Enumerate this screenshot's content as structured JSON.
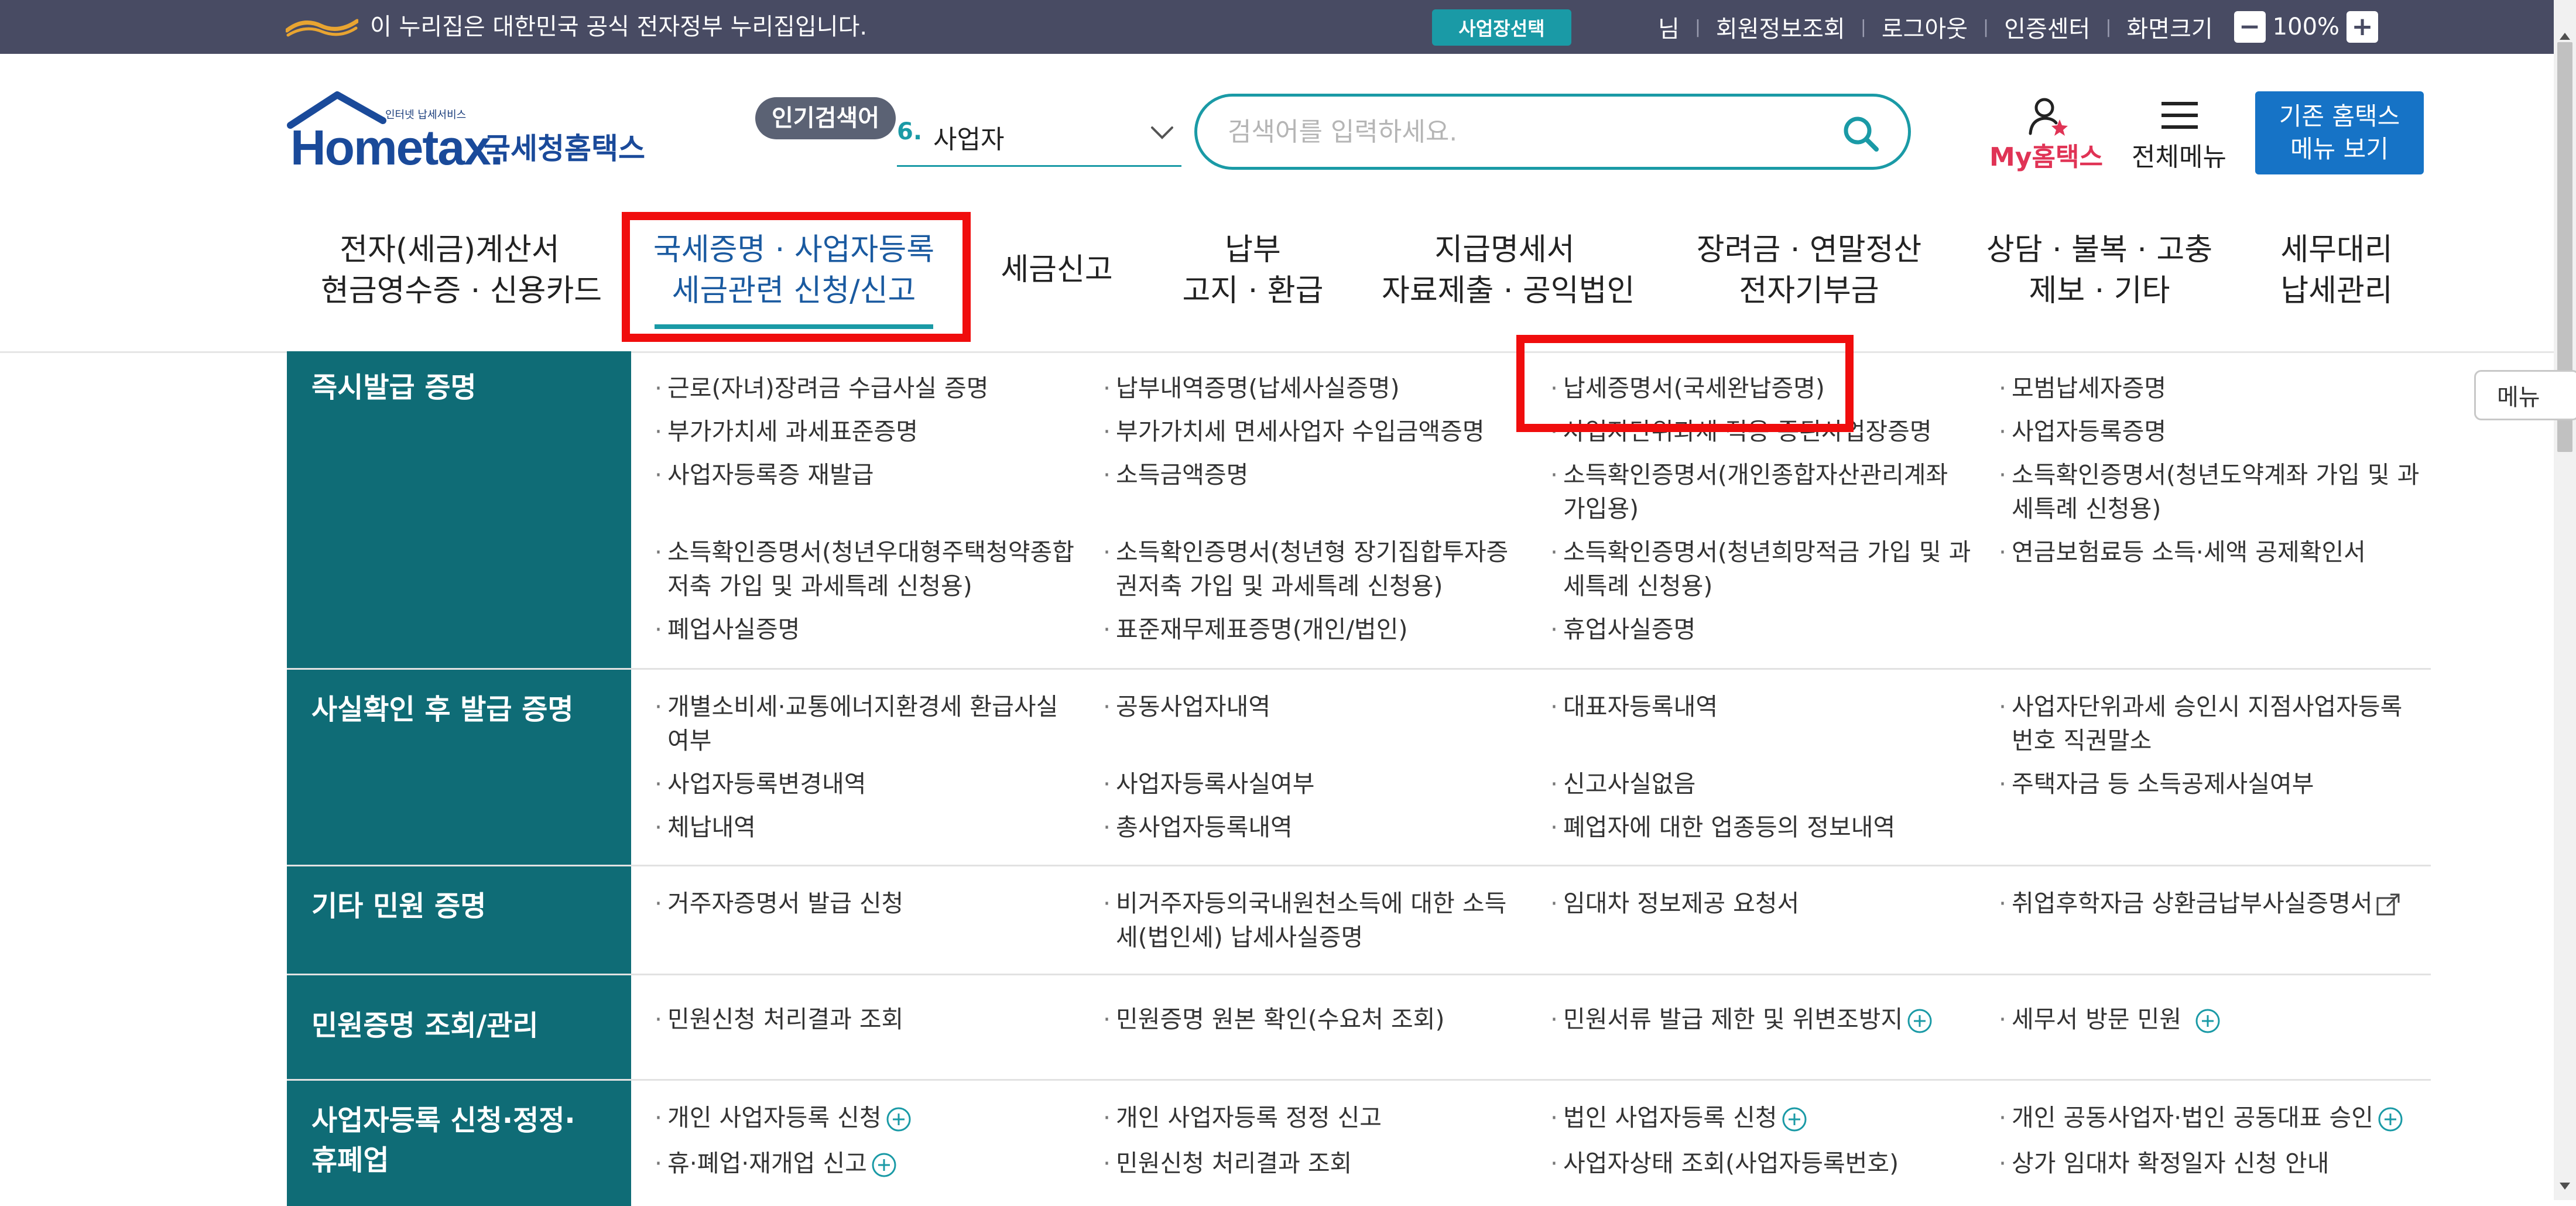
{
  "topbar": {
    "gov_notice": "이 누리집은 대한민국 공식 전자정부 누리집입니다.",
    "business_select": "사업장선택",
    "links": [
      "님",
      "회원정보조회",
      "로그아웃",
      "인증센터",
      "화면크기"
    ],
    "zoom_minus": "−",
    "zoom": "100%",
    "zoom_plus": "+"
  },
  "header": {
    "logo_tagline": "인터넷 납세서비스",
    "logo_main": "Hometax.",
    "logo_sub": "국세청홈택스",
    "popular_label": "인기검색어",
    "popular_rank": "6.",
    "popular_term": "사업자",
    "search_placeholder": "검색어를 입력하세요.",
    "my_hometax": "My홈택스",
    "all_menu": "전체메뉴",
    "old_menu_line1": "기존 홈택스",
    "old_menu_line2": "메뉴 보기",
    "side_menu": "메뉴"
  },
  "gnb": [
    {
      "line1": "전자(세금)계산서",
      "line2": "현금영수증 · 신용카드"
    },
    {
      "line1": "국세증명 · 사업자등록",
      "line2": "세금관련 신청/신고"
    },
    {
      "line1": "세금신고",
      "line2": ""
    },
    {
      "line1": "납부",
      "line2": "고지 · 환급"
    },
    {
      "line1": "지급명세서",
      "line2": "자료제출 · 공익법인"
    },
    {
      "line1": "장려금 · 연말정산",
      "line2": "전자기부금"
    },
    {
      "line1": "상담 · 불복 · 고충",
      "line2": "제보 · 기타"
    },
    {
      "line1": "세무대리",
      "line2": "납세관리"
    }
  ],
  "sections": [
    {
      "title": [
        "즉시발급 증명"
      ],
      "items": [
        [
          "근로(자녀)장려금 수급사실 증명"
        ],
        [
          "납부내역증명(납세사실증명)"
        ],
        [
          "납세증명서(국세완납증명)"
        ],
        [
          "모범납세자증명"
        ],
        [
          "부가가치세 과세표준증명"
        ],
        [
          "부가가치세 면세사업자 수입금액증명"
        ],
        [
          "사업자단위과세 적용 종된사업장증명"
        ],
        [
          "사업자등록증명"
        ],
        [
          "사업자등록증 재발급"
        ],
        [
          "소득금액증명"
        ],
        [
          "소득확인증명서(개인종합자산관리계좌",
          "가입용)"
        ],
        [
          "소득확인증명서(청년도약계좌 가입 및 과",
          "세특례 신청용)"
        ],
        [
          "소득확인증명서(청년우대형주택청약종합",
          "저축 가입 및 과세특례 신청용)"
        ],
        [
          "소득확인증명서(청년형 장기집합투자증",
          "권저축 가입 및 과세특례 신청용)"
        ],
        [
          "소득확인증명서(청년희망적금 가입 및 과",
          "세특례 신청용)"
        ],
        [
          "연금보험료등 소득·세액 공제확인서"
        ],
        [
          "폐업사실증명"
        ],
        [
          "표준재무제표증명(개인/법인)"
        ],
        [
          "휴업사실증명"
        ]
      ]
    },
    {
      "title": [
        "사실확인 후 발급 증명"
      ],
      "items": [
        [
          "개별소비세·교통에너지환경세 환급사실",
          "여부"
        ],
        [
          "공동사업자내역"
        ],
        [
          "대표자등록내역"
        ],
        [
          "사업자단위과세 승인시 지점사업자등록",
          "번호 직권말소"
        ],
        [
          "사업자등록변경내역"
        ],
        [
          "사업자등록사실여부"
        ],
        [
          "신고사실없음"
        ],
        [
          "주택자금 등 소득공제사실여부"
        ],
        [
          "체납내역"
        ],
        [
          "총사업자등록내역"
        ],
        [
          "폐업자에 대한 업종등의 정보내역"
        ]
      ]
    },
    {
      "title": [
        "기타 민원 증명"
      ],
      "items": [
        [
          "거주자증명서 발급 신청"
        ],
        [
          "비거주자등의국내원천소득에 대한 소득",
          "세(법인세) 납세사실증명"
        ],
        [
          "임대차 정보제공 요청서"
        ],
        [
          "취업후학자금 상환금납부사실증명서"
        ]
      ]
    },
    {
      "title": [
        "민원증명 조회/관리"
      ],
      "items": [
        [
          "민원신청 처리결과 조회"
        ],
        [
          "민원증명 원본 확인(수요처 조회)"
        ],
        [
          "민원서류 발급 제한 및 위변조방지"
        ],
        [
          "세무서 방문 민원"
        ]
      ]
    },
    {
      "title": [
        "사업자등록 신청·정정·",
        "휴폐업"
      ],
      "items": [
        [
          "개인 사업자등록 신청"
        ],
        [
          "개인 사업자등록 정정 신고"
        ],
        [
          "법인 사업자등록 신청"
        ],
        [
          "개인 공동사업자·법인 공동대표 승인"
        ],
        [
          "휴·폐업·재개업 신고"
        ],
        [
          "민원신청 처리결과 조회"
        ],
        [
          "사업자상태 조회(사업자등록번호)"
        ],
        [
          "상가 임대차 확정일자 신청 안내"
        ]
      ]
    }
  ],
  "colors": {
    "topbar_bg": "#484b63",
    "accent_teal": "#1a9aa6",
    "section_head_bg": "#0f6c76",
    "old_menu_btn": "#1673c6",
    "my_hometax": "#e03355",
    "highlight_red": "#f00d0d"
  },
  "icons": [
    "gov-emblem-icon",
    "search-icon",
    "chevron-down-icon",
    "user-star-icon",
    "hamburger-icon",
    "plus-circle-icon",
    "external-link-icon"
  ]
}
